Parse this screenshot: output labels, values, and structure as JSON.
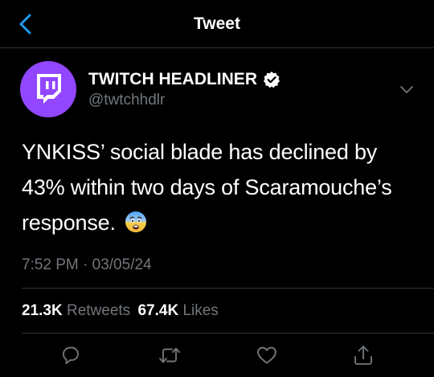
{
  "header": {
    "title": "Tweet"
  },
  "author": {
    "name": "TWITCH HEADLINER",
    "handle": "@twtchhdlr"
  },
  "tweet": {
    "text": "YNKISS’ social blade has declined by 43% within two days of Scaramouche’s response.",
    "emoji": "😨",
    "timestamp": "7:52 PM · 03/05/24"
  },
  "stats": {
    "retweets_count": "21.3K",
    "retweets_label": "Retweets",
    "likes_count": "67.4K",
    "likes_label": "Likes"
  },
  "icons": {
    "back": "chevron-left-icon",
    "verified": "verified-badge-icon",
    "caret": "chevron-down-icon",
    "reply": "reply-icon",
    "retweet": "retweet-icon",
    "like": "heart-icon",
    "share": "share-icon"
  },
  "colors": {
    "background": "#000000",
    "accent": "#1d9bf0",
    "twitch_purple": "#9146ff",
    "secondary_text": "#71767b",
    "divider": "#2f3336"
  }
}
